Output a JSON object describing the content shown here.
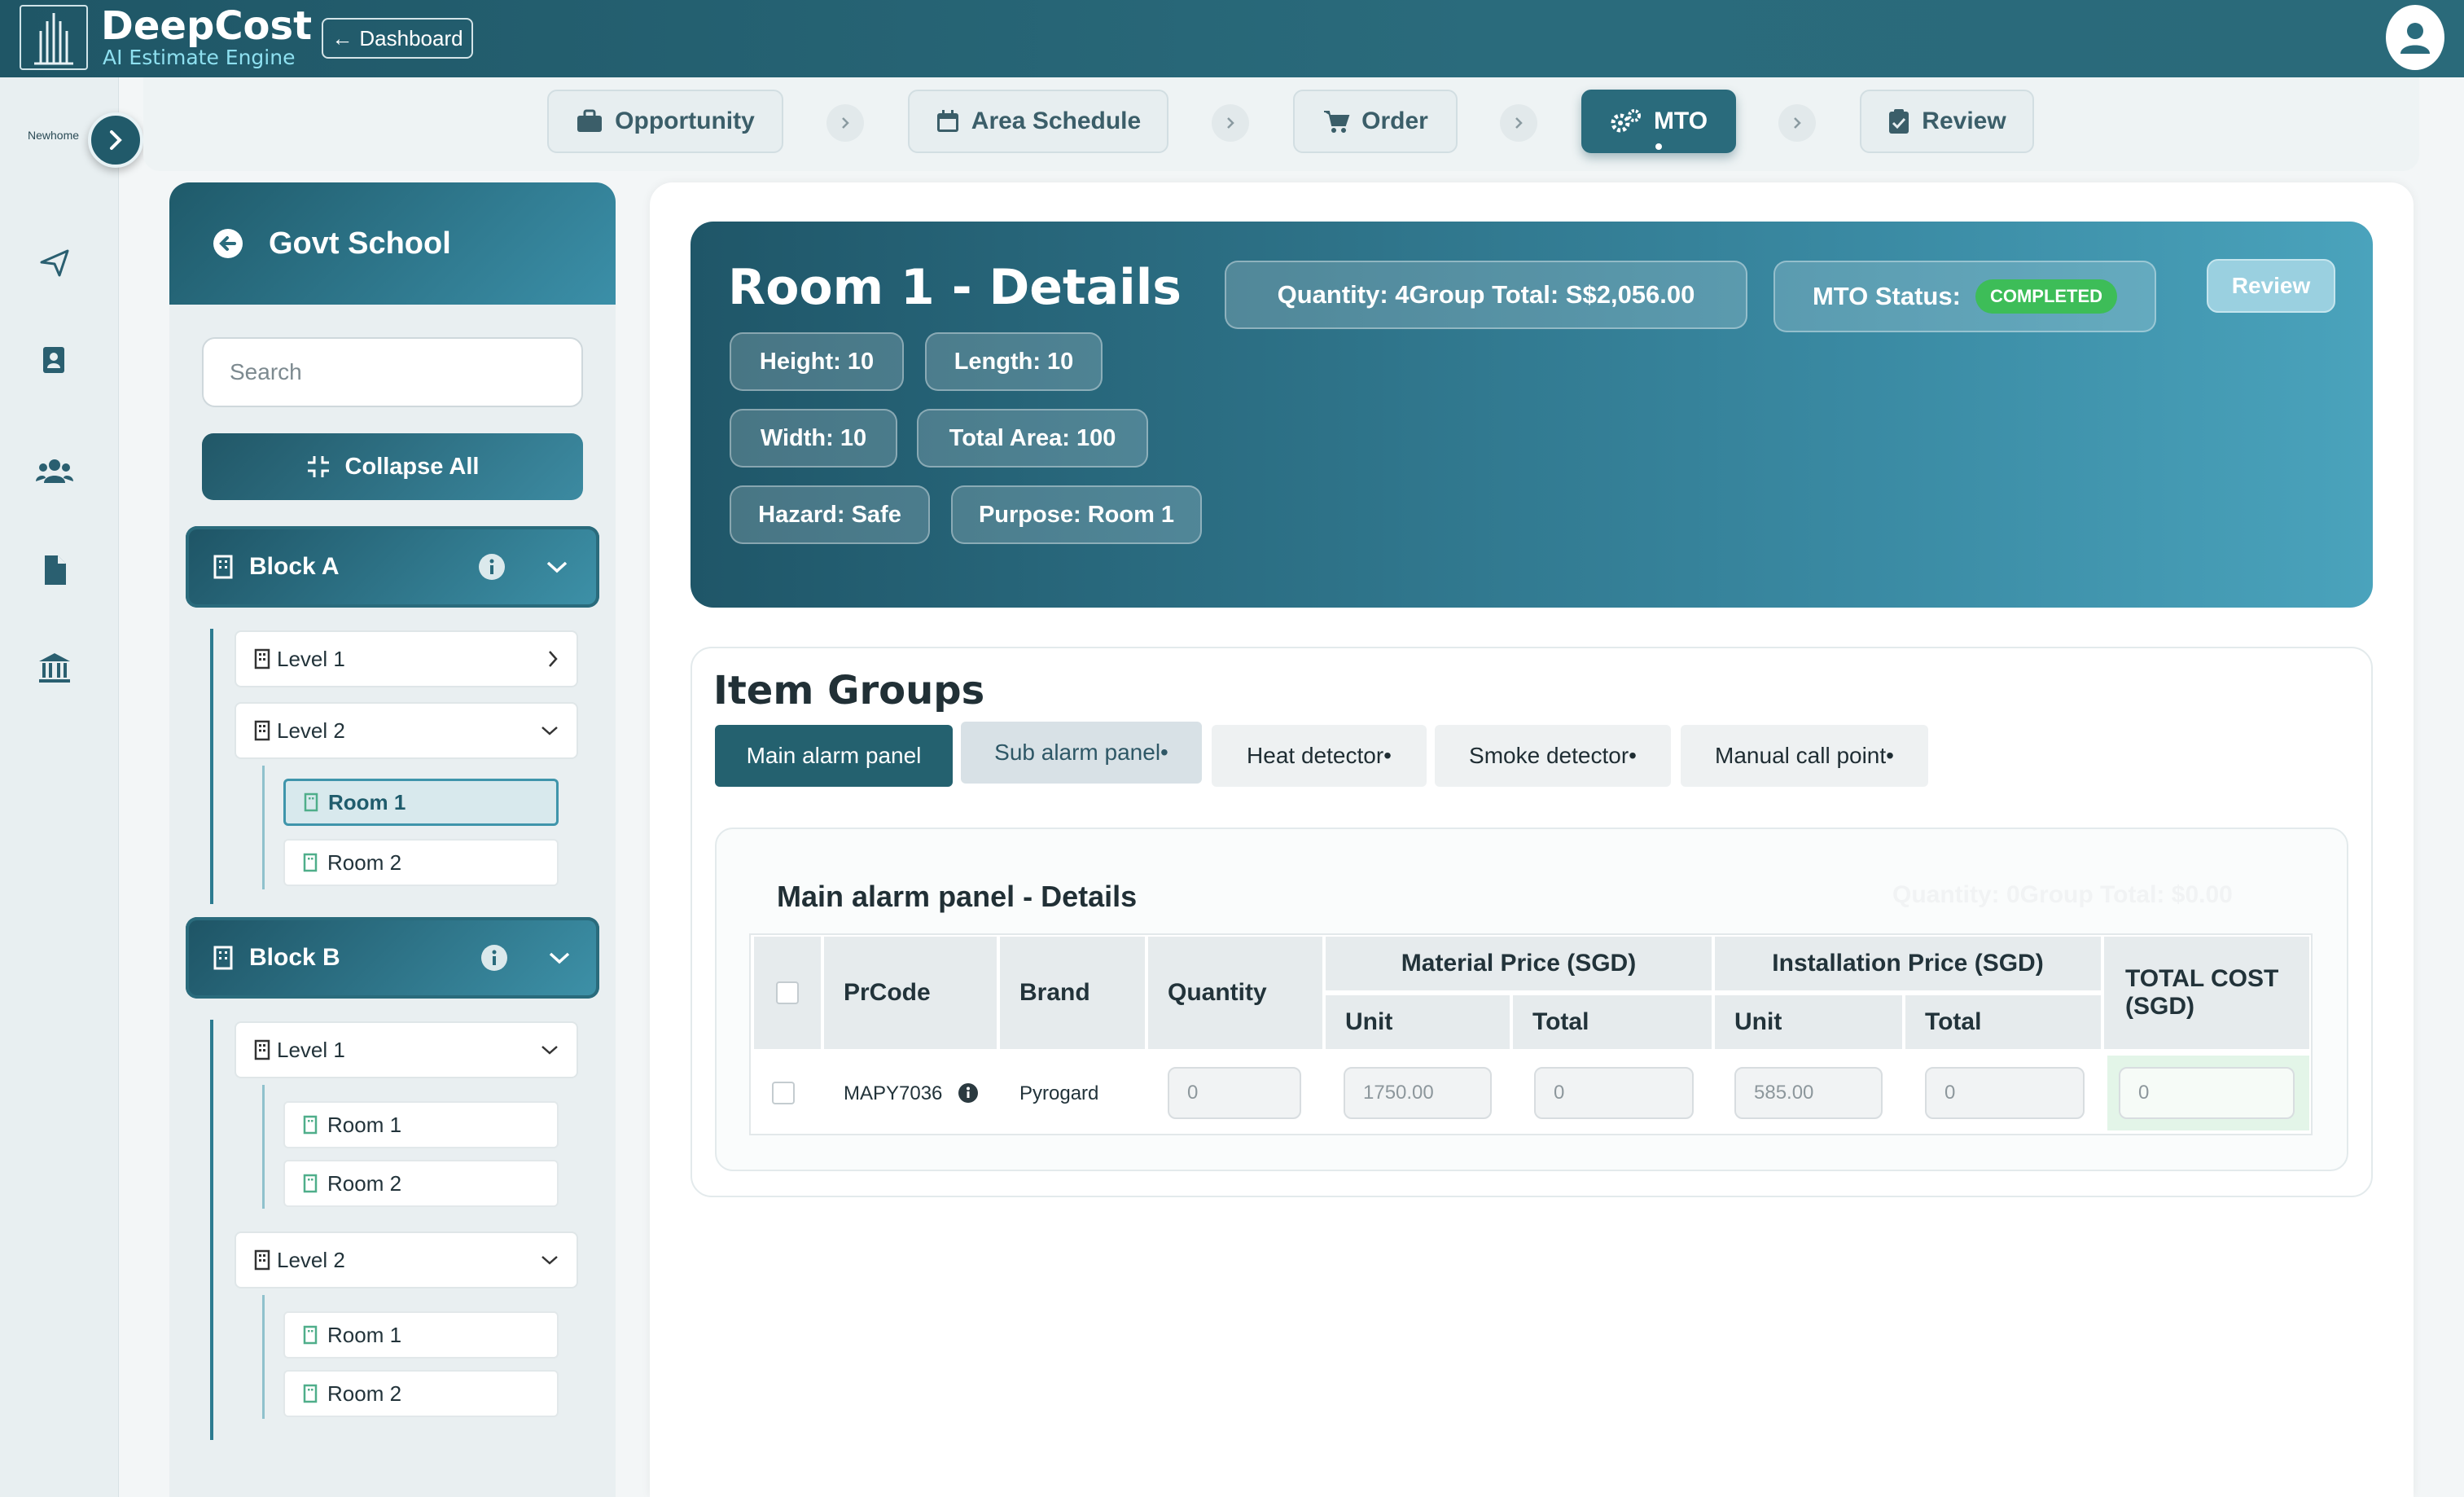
{
  "app": {
    "name": "DeepCost",
    "tagline": "AI Estimate Engine",
    "dashboard_label": "Dashboard",
    "org_logo": "Newhome"
  },
  "steps": [
    {
      "label": "Opportunity",
      "icon": "briefcase-icon"
    },
    {
      "label": "Area Schedule",
      "icon": "calendar-icon"
    },
    {
      "label": "Order",
      "icon": "cart-icon"
    },
    {
      "label": "MTO",
      "icon": "gears-icon",
      "active": true
    },
    {
      "label": "Review",
      "icon": "clipboard-check-icon"
    }
  ],
  "tree": {
    "project": "Govt School",
    "search_placeholder": "Search",
    "collapse_label": "Collapse All",
    "block_a": {
      "label": "Block A",
      "level1": "Level 1",
      "level2": "Level 2",
      "room1": "Room 1",
      "room2": "Room 2"
    },
    "block_b": {
      "label": "Block B",
      "level1": "Level 1",
      "l1_room1": "Room 1",
      "l1_room2": "Room 2",
      "level2": "Level 2",
      "l2_room1": "Room 1",
      "l2_room2": "Room 2"
    }
  },
  "room": {
    "title": "Room 1 - Details",
    "quantity_total": "Quantity: 4Group Total: S$2,056.00",
    "mto_status_label": "MTO Status:",
    "mto_status": "COMPLETED",
    "review_label": "Review",
    "height": "Height: 10",
    "length": "Length: 10",
    "width": "Width: 10",
    "total_area": "Total Area: 100",
    "hazard": "Hazard: Safe",
    "purpose": "Purpose: Room 1"
  },
  "item_groups": {
    "title": "Item Groups",
    "tabs": [
      "Main alarm panel",
      "Sub alarm panel•",
      "Heat detector•",
      "Smoke detector•",
      "Manual call point•"
    ]
  },
  "details": {
    "title": "Main alarm panel - Details",
    "faded_summary": "Quantity: 0Group Total: $0.00",
    "headers": {
      "prcode": "PrCode",
      "brand": "Brand",
      "quantity": "Quantity",
      "material": "Material Price (SGD)",
      "installation": "Installation Price (SGD)",
      "unit": "Unit",
      "total": "Total",
      "total_cost": "TOTAL COST (SGD)"
    },
    "row": {
      "prcode": "MAPY7036",
      "brand": "Pyrogard",
      "quantity": "0",
      "material_unit": "1750.00",
      "material_total": "0",
      "install_unit": "585.00",
      "install_total": "0",
      "total_cost": "0"
    }
  }
}
